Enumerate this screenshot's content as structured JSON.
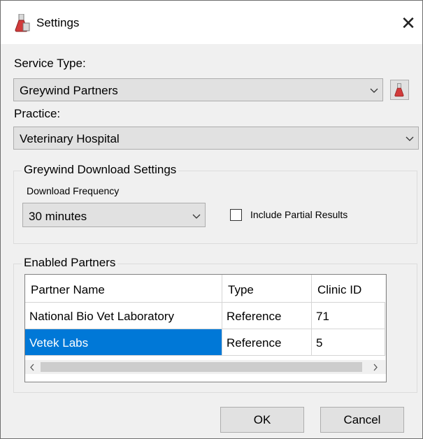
{
  "window": {
    "title": "Settings"
  },
  "service_type": {
    "label": "Service Type:",
    "value": "Greywind Partners"
  },
  "practice": {
    "label": "Practice:",
    "value": "Veterinary Hospital"
  },
  "download_settings": {
    "group_title": "Greywind Download Settings",
    "frequency_label": "Download Frequency",
    "frequency_value": "30 minutes",
    "include_partial_label": "Include Partial Results",
    "include_partial_checked": false
  },
  "partners": {
    "group_title": "Enabled Partners",
    "columns": [
      "Partner Name",
      "Type",
      "Clinic ID"
    ],
    "rows": [
      {
        "name": "National Bio Vet Laboratory",
        "type": "Reference",
        "clinic_id": "71",
        "selected": false
      },
      {
        "name": "Vetek Labs",
        "type": "Reference",
        "clinic_id": "5",
        "selected": true
      }
    ]
  },
  "buttons": {
    "ok": "OK",
    "cancel": "Cancel"
  },
  "icons": {
    "app": "flask-icon",
    "close": "close-icon",
    "service_action": "flask-icon"
  },
  "colors": {
    "selection": "#0078d7",
    "dialog_bg": "#f0f0f0"
  }
}
